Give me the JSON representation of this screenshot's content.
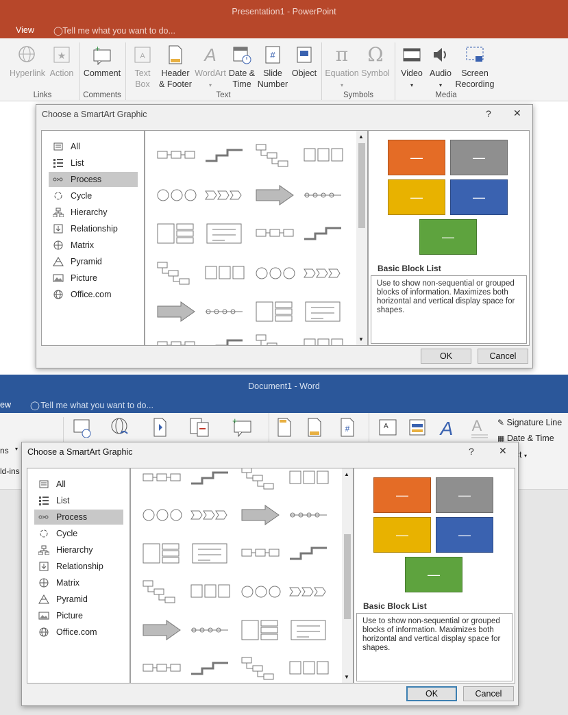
{
  "ppt": {
    "title": "Presentation1 - PowerPoint",
    "tab": "View",
    "tell_me": "Tell me what you want to do...",
    "ribbon": {
      "hyperlink": "Hyperlink",
      "action": "Action",
      "comment": "Comment",
      "text_box": [
        "Text",
        "Box"
      ],
      "header_footer": [
        "Header",
        "& Footer"
      ],
      "wordart": "WordArt",
      "date_time": [
        "Date &",
        "Time"
      ],
      "slide_number": [
        "Slide",
        "Number"
      ],
      "object": "Object",
      "equation": "Equation",
      "symbol": "Symbol",
      "video": "Video",
      "audio": "Audio",
      "screen_recording": [
        "Screen",
        "Recording"
      ],
      "groups": {
        "links": "Links",
        "comments": "Comments",
        "text": "Text",
        "symbols": "Symbols",
        "media": "Media"
      }
    }
  },
  "word": {
    "title": "Document1 - Word",
    "tab": "ew",
    "tell_me": "Tell me what you want to do...",
    "left_cut": [
      "ns",
      "ld-ins"
    ],
    "ribbon": {
      "signature_line": "Signature Line",
      "date_time": "Date & Time",
      "object": "ject"
    }
  },
  "dialog": {
    "title": "Choose a SmartArt Graphic",
    "help": "?",
    "close": "✕",
    "categories": [
      "All",
      "List",
      "Process",
      "Cycle",
      "Hierarchy",
      "Relationship",
      "Matrix",
      "Pyramid",
      "Picture",
      "Office.com"
    ],
    "selected_category": "Process",
    "preview_name": "Basic Block List",
    "preview_desc": "Use to show non-sequential or grouped blocks of information. Maximizes both horizontal and vertical display space for shapes.",
    "ok": "OK",
    "cancel": "Cancel",
    "block_dash": "—",
    "colors": {
      "orange": "#e46c26",
      "gray": "#8f8f8f",
      "gold": "#e8b200",
      "blue": "#3a62b0",
      "green": "#5ea33e"
    }
  }
}
